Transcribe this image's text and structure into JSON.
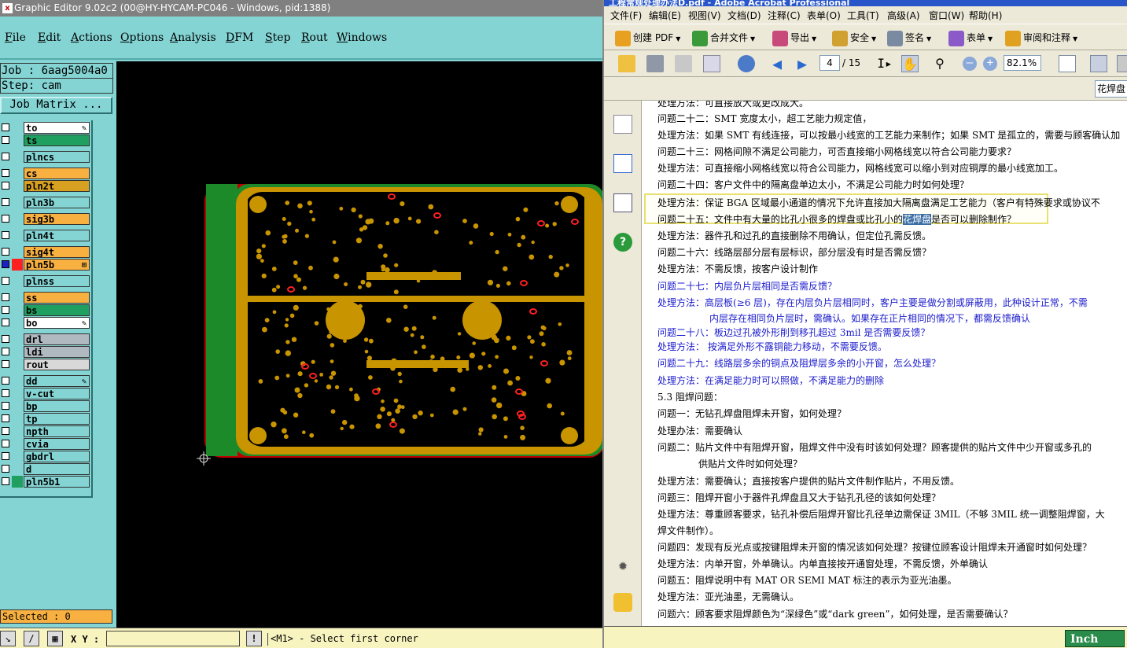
{
  "graphic_editor": {
    "title": "Graphic Editor 9.02c2 (00@HY-HYCAM-PC046 - Windows, pid:1388)",
    "menu": [
      "File",
      "Edit",
      "Actions",
      "Options",
      "Analysis",
      "DFM",
      "Step",
      "Rout",
      "Windows"
    ],
    "job_label": "Job : 6aag5004a0",
    "step_label": "Step: cam",
    "job_matrix_button": "Job Matrix ...",
    "layers": [
      {
        "name": "to",
        "color": "#ffffff",
        "checked": false,
        "swatch": "",
        "marker": "pen"
      },
      {
        "name": "ts",
        "color": "#1fa060",
        "checked": false,
        "swatch": "",
        "marker": ""
      },
      {
        "name": "plncs",
        "color": "#84d4d4",
        "checked": false,
        "swatch": "",
        "marker": ""
      },
      {
        "name": "cs",
        "color": "#f8b040",
        "checked": false,
        "swatch": "",
        "marker": ""
      },
      {
        "name": "pln2t",
        "color": "#d8a020",
        "checked": false,
        "swatch": "",
        "marker": ""
      },
      {
        "name": "pln3b",
        "color": "#84d4d4",
        "checked": false,
        "swatch": "",
        "marker": ""
      },
      {
        "name": "sig3b",
        "color": "#f8b040",
        "checked": false,
        "swatch": "",
        "marker": ""
      },
      {
        "name": "pln4t",
        "color": "#84d4d4",
        "checked": false,
        "swatch": "",
        "marker": ""
      },
      {
        "name": "sig4t",
        "color": "#f8b040",
        "checked": false,
        "swatch": "",
        "marker": ""
      },
      {
        "name": "pln5b",
        "color": "#f8b040",
        "checked": true,
        "swatch": "#ff2020",
        "marker": "mag"
      },
      {
        "name": "plnss",
        "color": "#84d4d4",
        "checked": false,
        "swatch": "",
        "marker": ""
      },
      {
        "name": "ss",
        "color": "#f8b040",
        "checked": false,
        "swatch": "",
        "marker": ""
      },
      {
        "name": "bs",
        "color": "#1fa060",
        "checked": false,
        "swatch": "",
        "marker": ""
      },
      {
        "name": "bo",
        "color": "#ffffff",
        "checked": false,
        "swatch": "",
        "marker": "pen"
      },
      {
        "name": "drl",
        "color": "#b0b8c0",
        "checked": false,
        "swatch": "",
        "marker": ""
      },
      {
        "name": "ldi",
        "color": "#b0b8c0",
        "checked": false,
        "swatch": "",
        "marker": ""
      },
      {
        "name": "rout",
        "color": "#d8d8d8",
        "checked": false,
        "swatch": "",
        "marker": ""
      },
      {
        "name": "dd",
        "color": "#84d4d4",
        "checked": false,
        "swatch": "",
        "marker": "pen"
      },
      {
        "name": "v-cut",
        "color": "#84d4d4",
        "checked": false,
        "swatch": "",
        "marker": ""
      },
      {
        "name": "bp",
        "color": "#84d4d4",
        "checked": false,
        "swatch": "",
        "marker": ""
      },
      {
        "name": "tp",
        "color": "#84d4d4",
        "checked": false,
        "swatch": "",
        "marker": ""
      },
      {
        "name": "npth",
        "color": "#84d4d4",
        "checked": false,
        "swatch": "",
        "marker": ""
      },
      {
        "name": "cvia",
        "color": "#84d4d4",
        "checked": false,
        "swatch": "",
        "marker": ""
      },
      {
        "name": "gbdrl",
        "color": "#84d4d4",
        "checked": false,
        "swatch": "",
        "marker": ""
      },
      {
        "name": "d",
        "color": "#84d4d4",
        "checked": false,
        "swatch": "",
        "marker": ""
      },
      {
        "name": "pln5b1",
        "color": "#84d4d4",
        "checked": false,
        "swatch": "#1fa060",
        "marker": ""
      }
    ],
    "selected_label": "Selected : 0",
    "xy_label": "X Y :",
    "status_message": "<M1> - Select first corner",
    "unit_button": "Inch"
  },
  "acrobat": {
    "title": "工程常规处理办法D.pdf - Adobe Acrobat Professional",
    "menu": [
      "文件(F)",
      "编辑(E)",
      "视图(V)",
      "文档(D)",
      "注释(C)",
      "表单(O)",
      "工具(T)",
      "高级(A)",
      "窗口(W)",
      "帮助(H)"
    ],
    "toolbar1": [
      "创建 PDF",
      "合并文件",
      "导出",
      "安全",
      "签名",
      "表单",
      "审阅和注释"
    ],
    "page_current": "4",
    "page_total": "/ 15",
    "zoom": "82.1%",
    "find_text": "花焊盘",
    "doc_lines": [
      {
        "text": "处理方法：可直接放大或更改成大。",
        "blue": false
      },
      {
        "text": "问题二十二：SMT 宽度太小，超工艺能力规定值，",
        "blue": false
      },
      {
        "text": "处理方法：如果 SMT 有线连接，可以按最小线宽的工艺能力来制作；如果 SMT 是孤立的，需要与顾客确认加",
        "blue": false
      },
      {
        "text": "问题二十三：网格间隙不满足公司能力，可否直接缩小网格线宽以符合公司能力要求？",
        "blue": false
      },
      {
        "text": "处理方法：可直接缩小网格线宽以符合公司能力，网格线宽可以缩小到对应铜厚的最小线宽加工。",
        "blue": false
      },
      {
        "text": "问题二十四：客户文件中的隔离盘单边太小，不满足公司能力时如何处理？",
        "blue": false
      },
      {
        "text": "处理方法：保证 BGA 区域最小通道的情况下允许直接加大隔离盘满足工艺能力（客户有特殊要求或协议不",
        "blue": false
      },
      {
        "text": "问题二十五：文件中有大量的比孔小很多的焊盘或比孔小的",
        "blue": false,
        "sel": "花焊盘",
        "after": "是否可以删除制作？"
      },
      {
        "text": "处理方法：器件孔和过孔的直接删除不用确认，但定位孔需反馈。",
        "blue": false
      },
      {
        "text": "问题二十六：线路层部分层有层标识，部分层没有时是否需反馈？",
        "blue": false
      },
      {
        "text": "处理方法：不需反馈，按客户设计制作",
        "blue": false
      },
      {
        "text": "问题二十七：内层负片层相同是否需反馈？",
        "blue": true
      },
      {
        "text": "处理方法：高层板(≥6 层)，存在内层负片层相同时，客户主要是做分割或屏蔽用，此种设计正常，不需",
        "blue": true
      },
      {
        "text": "内层存在相同负片层时，需确认。如果存在正片相同的情况下，都需反馈确认",
        "blue": true
      },
      {
        "text": "问题二十八：板边过孔被外形削到移孔超过 3mil 是否需要反馈？",
        "blue": true
      },
      {
        "text": "处理方法： 按满足外形不露铜能力移动，不需要反馈。",
        "blue": true
      },
      {
        "text": "问题二十九：线路层多余的铜点及阻焊层多余的小开窗，怎么处理？",
        "blue": true
      },
      {
        "text": "处理方法：在满足能力时可以照做，不满足能力的删除",
        "blue": true
      },
      {
        "text": "5.3 阻焊问题：",
        "blue": false
      },
      {
        "text": "问题一：无钻孔焊盘阻焊未开窗，如何处理？",
        "blue": false
      },
      {
        "text": "处理办法：需要确认",
        "blue": false
      },
      {
        "text": "问题二：贴片文件中有阻焊开窗，阻焊文件中没有时该如何处理？顾客提供的贴片文件中少开窗或多孔的",
        "blue": false
      },
      {
        "text": "供贴片文件时如何处理？",
        "blue": false
      },
      {
        "text": "处理方法：需要确认；直接按客户提供的贴片文件制作贴片，不用反馈。",
        "blue": false
      },
      {
        "text": "问题三：阻焊开窗小于器件孔焊盘且又大于钻孔孔径的该如何处理？",
        "blue": false
      },
      {
        "text": "处理方法：尊重顾客要求，钻孔补偿后阻焊开窗比孔径单边需保证 3MIL（不够 3MIL 统一调整阻焊窗，大",
        "blue": false
      },
      {
        "text": "焊文件制作）。",
        "blue": false
      },
      {
        "text": "问题四：发现有反光点或按键阻焊未开窗的情况该如何处理？按键位顾客设计阻焊未开通窗时如何处理？",
        "blue": false
      },
      {
        "text": "处理方法：内单开窗，外单确认。内单直接按开通窗处理，不需反馈，外单确认",
        "blue": false
      },
      {
        "text": "问题五：阻焊说明中有 MAT OR SEMI MAT 标注的表示为亚光油墨。",
        "blue": false
      },
      {
        "text": "处理方法：亚光油墨，无需确认。",
        "blue": false
      },
      {
        "text": "问题六：顾客要求阻焊颜色为“深绿色”或“dark green”，如何处理，是否需要确认？",
        "blue": false
      }
    ]
  }
}
